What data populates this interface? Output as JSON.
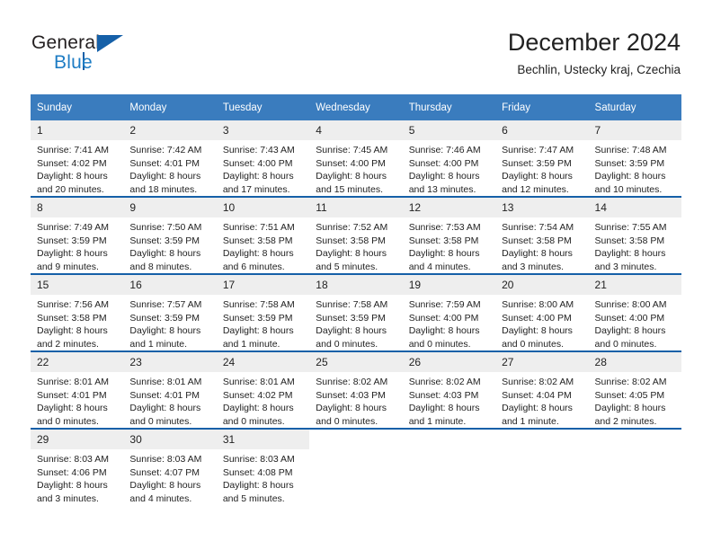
{
  "brand": {
    "name_part1": "General",
    "name_part2": "Blue",
    "logo_icon": "triangle-flag-icon"
  },
  "header": {
    "title": "December 2024",
    "location": "Bechlin, Ustecky kraj, Czechia"
  },
  "colors": {
    "header_blue": "#3a7cbe",
    "row_border_blue": "#1560a8",
    "daynum_gray": "#eeeeee",
    "brand_blue": "#1d7cc4",
    "text": "#222222"
  },
  "weekdays": [
    "Sunday",
    "Monday",
    "Tuesday",
    "Wednesday",
    "Thursday",
    "Friday",
    "Saturday"
  ],
  "weeks": [
    [
      {
        "day": "1",
        "sunrise": "Sunrise: 7:41 AM",
        "sunset": "Sunset: 4:02 PM",
        "daylight1": "Daylight: 8 hours",
        "daylight2": "and 20 minutes."
      },
      {
        "day": "2",
        "sunrise": "Sunrise: 7:42 AM",
        "sunset": "Sunset: 4:01 PM",
        "daylight1": "Daylight: 8 hours",
        "daylight2": "and 18 minutes."
      },
      {
        "day": "3",
        "sunrise": "Sunrise: 7:43 AM",
        "sunset": "Sunset: 4:00 PM",
        "daylight1": "Daylight: 8 hours",
        "daylight2": "and 17 minutes."
      },
      {
        "day": "4",
        "sunrise": "Sunrise: 7:45 AM",
        "sunset": "Sunset: 4:00 PM",
        "daylight1": "Daylight: 8 hours",
        "daylight2": "and 15 minutes."
      },
      {
        "day": "5",
        "sunrise": "Sunrise: 7:46 AM",
        "sunset": "Sunset: 4:00 PM",
        "daylight1": "Daylight: 8 hours",
        "daylight2": "and 13 minutes."
      },
      {
        "day": "6",
        "sunrise": "Sunrise: 7:47 AM",
        "sunset": "Sunset: 3:59 PM",
        "daylight1": "Daylight: 8 hours",
        "daylight2": "and 12 minutes."
      },
      {
        "day": "7",
        "sunrise": "Sunrise: 7:48 AM",
        "sunset": "Sunset: 3:59 PM",
        "daylight1": "Daylight: 8 hours",
        "daylight2": "and 10 minutes."
      }
    ],
    [
      {
        "day": "8",
        "sunrise": "Sunrise: 7:49 AM",
        "sunset": "Sunset: 3:59 PM",
        "daylight1": "Daylight: 8 hours",
        "daylight2": "and 9 minutes."
      },
      {
        "day": "9",
        "sunrise": "Sunrise: 7:50 AM",
        "sunset": "Sunset: 3:59 PM",
        "daylight1": "Daylight: 8 hours",
        "daylight2": "and 8 minutes."
      },
      {
        "day": "10",
        "sunrise": "Sunrise: 7:51 AM",
        "sunset": "Sunset: 3:58 PM",
        "daylight1": "Daylight: 8 hours",
        "daylight2": "and 6 minutes."
      },
      {
        "day": "11",
        "sunrise": "Sunrise: 7:52 AM",
        "sunset": "Sunset: 3:58 PM",
        "daylight1": "Daylight: 8 hours",
        "daylight2": "and 5 minutes."
      },
      {
        "day": "12",
        "sunrise": "Sunrise: 7:53 AM",
        "sunset": "Sunset: 3:58 PM",
        "daylight1": "Daylight: 8 hours",
        "daylight2": "and 4 minutes."
      },
      {
        "day": "13",
        "sunrise": "Sunrise: 7:54 AM",
        "sunset": "Sunset: 3:58 PM",
        "daylight1": "Daylight: 8 hours",
        "daylight2": "and 3 minutes."
      },
      {
        "day": "14",
        "sunrise": "Sunrise: 7:55 AM",
        "sunset": "Sunset: 3:58 PM",
        "daylight1": "Daylight: 8 hours",
        "daylight2": "and 3 minutes."
      }
    ],
    [
      {
        "day": "15",
        "sunrise": "Sunrise: 7:56 AM",
        "sunset": "Sunset: 3:58 PM",
        "daylight1": "Daylight: 8 hours",
        "daylight2": "and 2 minutes."
      },
      {
        "day": "16",
        "sunrise": "Sunrise: 7:57 AM",
        "sunset": "Sunset: 3:59 PM",
        "daylight1": "Daylight: 8 hours",
        "daylight2": "and 1 minute."
      },
      {
        "day": "17",
        "sunrise": "Sunrise: 7:58 AM",
        "sunset": "Sunset: 3:59 PM",
        "daylight1": "Daylight: 8 hours",
        "daylight2": "and 1 minute."
      },
      {
        "day": "18",
        "sunrise": "Sunrise: 7:58 AM",
        "sunset": "Sunset: 3:59 PM",
        "daylight1": "Daylight: 8 hours",
        "daylight2": "and 0 minutes."
      },
      {
        "day": "19",
        "sunrise": "Sunrise: 7:59 AM",
        "sunset": "Sunset: 4:00 PM",
        "daylight1": "Daylight: 8 hours",
        "daylight2": "and 0 minutes."
      },
      {
        "day": "20",
        "sunrise": "Sunrise: 8:00 AM",
        "sunset": "Sunset: 4:00 PM",
        "daylight1": "Daylight: 8 hours",
        "daylight2": "and 0 minutes."
      },
      {
        "day": "21",
        "sunrise": "Sunrise: 8:00 AM",
        "sunset": "Sunset: 4:00 PM",
        "daylight1": "Daylight: 8 hours",
        "daylight2": "and 0 minutes."
      }
    ],
    [
      {
        "day": "22",
        "sunrise": "Sunrise: 8:01 AM",
        "sunset": "Sunset: 4:01 PM",
        "daylight1": "Daylight: 8 hours",
        "daylight2": "and 0 minutes."
      },
      {
        "day": "23",
        "sunrise": "Sunrise: 8:01 AM",
        "sunset": "Sunset: 4:01 PM",
        "daylight1": "Daylight: 8 hours",
        "daylight2": "and 0 minutes."
      },
      {
        "day": "24",
        "sunrise": "Sunrise: 8:01 AM",
        "sunset": "Sunset: 4:02 PM",
        "daylight1": "Daylight: 8 hours",
        "daylight2": "and 0 minutes."
      },
      {
        "day": "25",
        "sunrise": "Sunrise: 8:02 AM",
        "sunset": "Sunset: 4:03 PM",
        "daylight1": "Daylight: 8 hours",
        "daylight2": "and 0 minutes."
      },
      {
        "day": "26",
        "sunrise": "Sunrise: 8:02 AM",
        "sunset": "Sunset: 4:03 PM",
        "daylight1": "Daylight: 8 hours",
        "daylight2": "and 1 minute."
      },
      {
        "day": "27",
        "sunrise": "Sunrise: 8:02 AM",
        "sunset": "Sunset: 4:04 PM",
        "daylight1": "Daylight: 8 hours",
        "daylight2": "and 1 minute."
      },
      {
        "day": "28",
        "sunrise": "Sunrise: 8:02 AM",
        "sunset": "Sunset: 4:05 PM",
        "daylight1": "Daylight: 8 hours",
        "daylight2": "and 2 minutes."
      }
    ],
    [
      {
        "day": "29",
        "sunrise": "Sunrise: 8:03 AM",
        "sunset": "Sunset: 4:06 PM",
        "daylight1": "Daylight: 8 hours",
        "daylight2": "and 3 minutes."
      },
      {
        "day": "30",
        "sunrise": "Sunrise: 8:03 AM",
        "sunset": "Sunset: 4:07 PM",
        "daylight1": "Daylight: 8 hours",
        "daylight2": "and 4 minutes."
      },
      {
        "day": "31",
        "sunrise": "Sunrise: 8:03 AM",
        "sunset": "Sunset: 4:08 PM",
        "daylight1": "Daylight: 8 hours",
        "daylight2": "and 5 minutes."
      },
      {
        "day": "",
        "sunrise": "",
        "sunset": "",
        "daylight1": "",
        "daylight2": ""
      },
      {
        "day": "",
        "sunrise": "",
        "sunset": "",
        "daylight1": "",
        "daylight2": ""
      },
      {
        "day": "",
        "sunrise": "",
        "sunset": "",
        "daylight1": "",
        "daylight2": ""
      },
      {
        "day": "",
        "sunrise": "",
        "sunset": "",
        "daylight1": "",
        "daylight2": ""
      }
    ]
  ]
}
